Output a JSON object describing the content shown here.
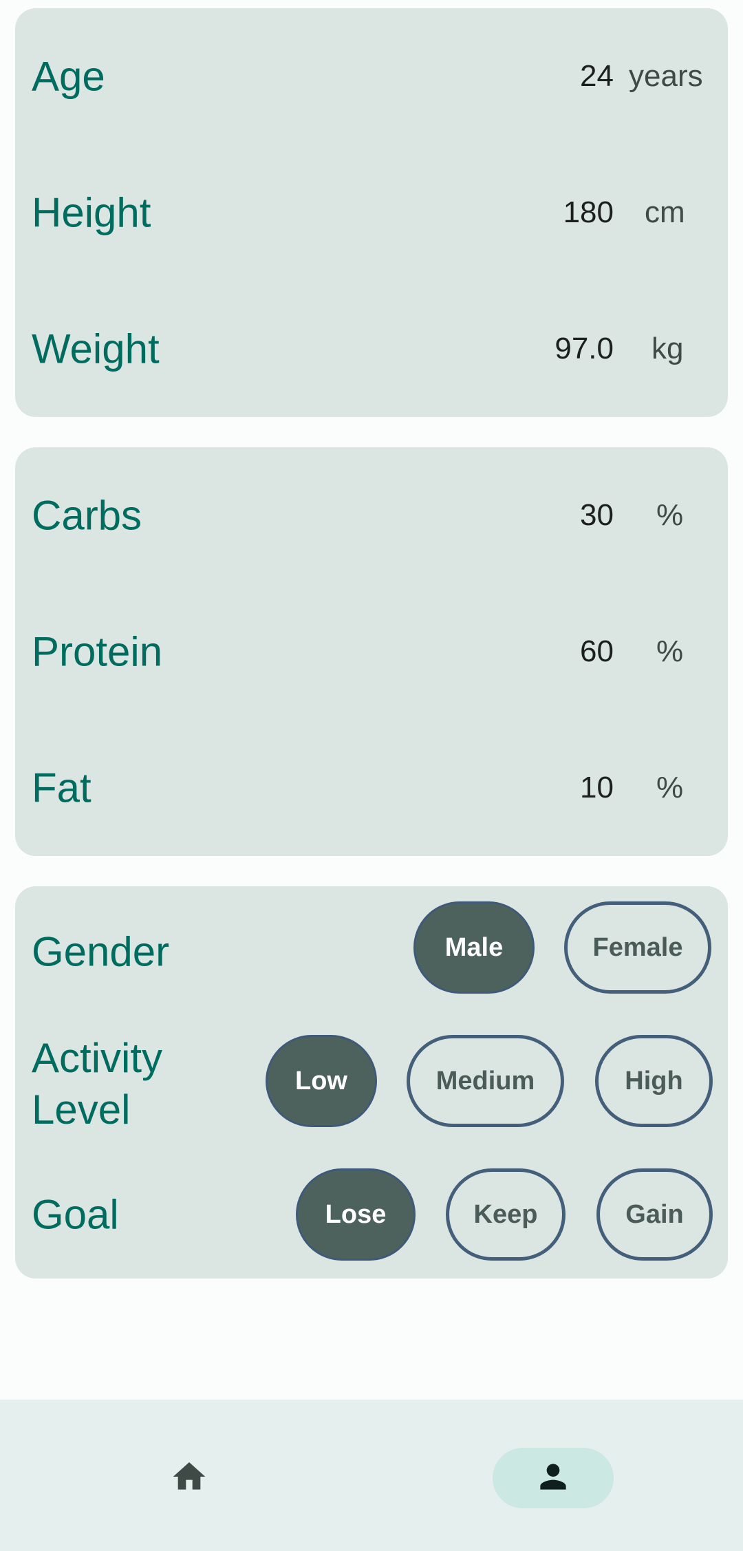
{
  "body_metrics": [
    {
      "label": "Age",
      "value": "24",
      "unit": "years"
    },
    {
      "label": "Height",
      "value": "180",
      "unit": "cm"
    },
    {
      "label": "Weight",
      "value": "97.0",
      "unit": "kg"
    }
  ],
  "macros": [
    {
      "label": "Carbs",
      "value": "30",
      "unit": "%"
    },
    {
      "label": "Protein",
      "value": "60",
      "unit": "%"
    },
    {
      "label": "Fat",
      "value": "10",
      "unit": "%"
    }
  ],
  "preferences": {
    "gender": {
      "label": "Gender",
      "options": [
        "Male",
        "Female"
      ],
      "selected": "Male"
    },
    "activity": {
      "label_line1": "Activity",
      "label_line2": "Level",
      "options": [
        "Low",
        "Medium",
        "High"
      ],
      "selected": "Low"
    },
    "goal": {
      "label": "Goal",
      "options": [
        "Lose",
        "Keep",
        "Gain"
      ],
      "selected": "Lose"
    }
  },
  "bottom_nav": {
    "items": [
      {
        "icon": "home-icon",
        "active": false
      },
      {
        "icon": "person-icon",
        "active": true
      }
    ]
  },
  "colors": {
    "accent": "#006c5f",
    "card": "#dbe5e2",
    "selected_chip": "#4d625d",
    "chip_border": "#445f7a",
    "nav_bg": "#e5efed",
    "nav_active": "#cce8e2"
  }
}
